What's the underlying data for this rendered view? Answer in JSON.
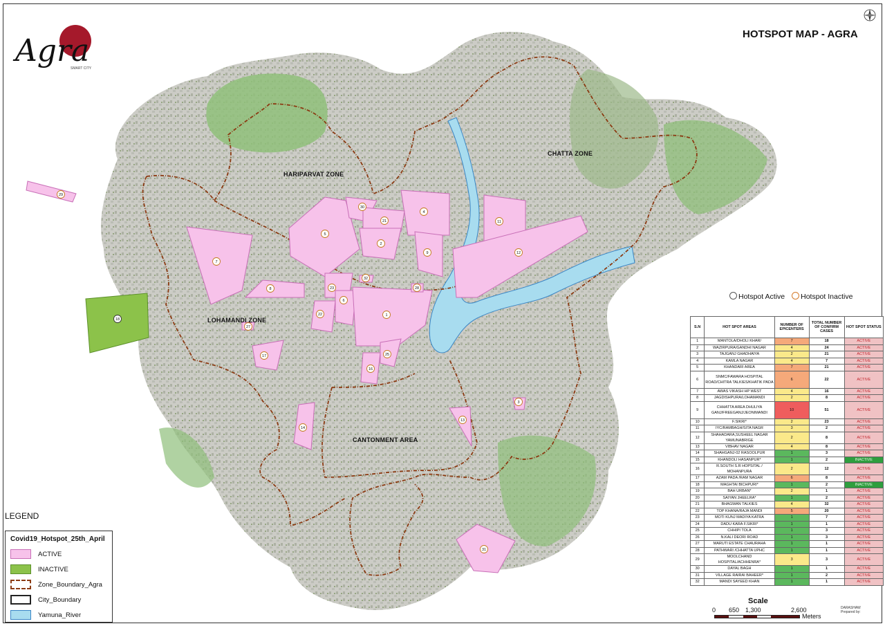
{
  "title": "HOTSPOT MAP - AGRA",
  "logo": {
    "text": "Agra",
    "sub": "SMART CITY"
  },
  "zones": [
    {
      "name": "HARIPARVAT ZONE"
    },
    {
      "name": "CHATTA ZONE"
    },
    {
      "name": "LOHAMANDI ZONE"
    },
    {
      "name": "CANTONMENT AREA"
    }
  ],
  "status_legend": {
    "active": "Hotspot Active",
    "inactive": "Hotspot Inactive"
  },
  "hotspot_labels": [
    "1",
    "2",
    "3",
    "4",
    "5",
    "6",
    "7",
    "8",
    "9",
    "10",
    "11",
    "12",
    "13",
    "14",
    "15",
    "16",
    "17",
    "18",
    "19",
    "20",
    "21",
    "22",
    "23",
    "24",
    "25",
    "26",
    "27",
    "28",
    "29",
    "30",
    "31",
    "32"
  ],
  "table": {
    "headers": [
      "S.N",
      "HOT SPOT AREAS",
      "NUMBER OF EPICENTERS",
      "TOTAL NUMBER OF CONFIRM CASES",
      "HOT SPOT STATUS"
    ],
    "rows": [
      {
        "sn": "1",
        "area": "MANTOLA/DHOLI KHAR/",
        "epi": "7",
        "cases": "18",
        "status": "ACTIVE"
      },
      {
        "sn": "2",
        "area": "WAZIRPURA/GANDHI NAGAR",
        "epi": "4",
        "cases": "24",
        "status": "ACTIVE"
      },
      {
        "sn": "3",
        "area": "TAJGANJ GHADHAIYA",
        "epi": "2",
        "cases": "21",
        "status": "ACTIVE"
      },
      {
        "sn": "4",
        "area": "KAMLA NAGAR",
        "epi": "4",
        "cases": "7",
        "status": "ACTIVE"
      },
      {
        "sn": "5",
        "area": "KHANDARI AREA",
        "epi": "7",
        "cases": "21",
        "status": "ACTIVE"
      },
      {
        "sn": "6",
        "area": "SNMC/FAWARA HOSPITAL ROAD/CHITRA TALKIES/KHATIK PADA",
        "epi": "6",
        "cases": "22",
        "status": "ACTIVE"
      },
      {
        "sn": "7",
        "area": "AWAS VIKASH HP WEST",
        "epi": "4",
        "cases": "16",
        "status": "ACTIVE"
      },
      {
        "sn": "8",
        "area": "JAGDISHPURA/LOHAMANDI",
        "epi": "2",
        "cases": "8",
        "status": "ACTIVE"
      },
      {
        "sn": "9",
        "area": "CHHATTA AREA DHULIYA GANJ/FREEGANJ/JEONIMANDI",
        "epi": "10",
        "cases": "51",
        "status": "ACTIVE"
      },
      {
        "sn": "10",
        "area": "F.SIKRI*",
        "epi": "2",
        "cases": "23",
        "status": "ACTIVE"
      },
      {
        "sn": "11",
        "area": "IYC/RAMBAGH/SITA NAGR",
        "epi": "3",
        "cases": "2",
        "status": "ACTIVE"
      },
      {
        "sn": "12",
        "area": "SHAHADARA,SUSHEEL NAGAR YAMUNABRIGE",
        "epi": "2",
        "cases": "8",
        "status": "ACTIVE"
      },
      {
        "sn": "13",
        "area": "VIBHAV NAGAR",
        "epi": "4",
        "cases": "8",
        "status": "ACTIVE"
      },
      {
        "sn": "14",
        "area": "SHAHGANJ-02 RASOOLPUR",
        "epi": "1",
        "cases": "3",
        "status": "ACTIVE"
      },
      {
        "sn": "15",
        "area": "KHANDOLI HASANPUR*",
        "epi": "1",
        "cases": "2",
        "status": "INACTIVE"
      },
      {
        "sn": "16",
        "area": "R.SOUTH  S.R HOPSITAL / MOHANPURA",
        "epi": "2",
        "cases": "12",
        "status": "ACTIVE"
      },
      {
        "sn": "17",
        "area": "AZAM PADA /RAM NAGAR",
        "epi": "6",
        "cases": "8",
        "status": "ACTIVE"
      },
      {
        "sn": "18",
        "area": "MAGHTAI BICHPURI*",
        "epi": "1",
        "cases": "2",
        "status": "INACTIVE"
      },
      {
        "sn": "19",
        "area": "BAH URBAN*",
        "epi": "2",
        "cases": "1",
        "status": "ACTIVE"
      },
      {
        "sn": "20",
        "area": "SAIYAN JHEELRA*",
        "epi": "1",
        "cases": "2",
        "status": "ACTIVE"
      },
      {
        "sn": "21",
        "area": "BHAGWAN TALKIES",
        "epi": "4",
        "cases": "32",
        "status": "ACTIVE"
      },
      {
        "sn": "22",
        "area": "TOP KHANA/RAJA MANDI",
        "epi": "5",
        "cases": "20",
        "status": "ACTIVE"
      },
      {
        "sn": "23",
        "area": "MOTI KUNJ MADIYA KATRA",
        "epi": "1",
        "cases": "7",
        "status": "ACTIVE"
      },
      {
        "sn": "24",
        "area": "DADU KARA F.SIKRI*",
        "epi": "1",
        "cases": "1",
        "status": "ACTIVE"
      },
      {
        "sn": "25",
        "area": "CHHIPI TOLA",
        "epi": "1",
        "cases": "3",
        "status": "ACTIVE"
      },
      {
        "sn": "26",
        "area": "N.KALI DEORI ROAD",
        "epi": "1",
        "cases": "3",
        "status": "ACTIVE"
      },
      {
        "sn": "27",
        "area": "MARUTI ESTATE CHAURAHA",
        "epi": "1",
        "cases": "1",
        "status": "ACTIVE"
      },
      {
        "sn": "28",
        "area": "PATHWARI /CHHATTA UPHC",
        "epi": "1",
        "cases": "1",
        "status": "ACTIVE"
      },
      {
        "sn": "29",
        "area": "MOOLCHAND HOSPITAL/ACHHENRA*",
        "epi": "3",
        "cases": "3",
        "status": "ACTIVE"
      },
      {
        "sn": "30",
        "area": "DAYAL BAGH",
        "epi": "1",
        "cases": "1",
        "status": "ACTIVE"
      },
      {
        "sn": "31",
        "area": "VILLAGE RAIRAI BAHEER*",
        "epi": "1",
        "cases": "2",
        "status": "ACTIVE"
      },
      {
        "sn": "32",
        "area": "MANDI SAYEED KHAN",
        "epi": "1",
        "cases": "1",
        "status": "ACTIVE"
      }
    ]
  },
  "legend": {
    "title": "LEGEND",
    "subtitle": "Covid19_Hotspot_25th_April",
    "items": [
      {
        "label": "ACTIVE",
        "color": "#f7c2ea"
      },
      {
        "label": "INACTIVE",
        "color": "#8cc24a"
      },
      {
        "label": "Zone_Boundary_Agra",
        "color": "#8b3a12"
      },
      {
        "label": "City_Boundary",
        "color": "#222222"
      },
      {
        "label": "Yamuna_River",
        "color": "#a8dcef"
      }
    ]
  },
  "scale": {
    "title": "Scale",
    "ticks": [
      "0",
      "650",
      "1,300",
      "2,600"
    ],
    "units": "Meters"
  },
  "credits": {
    "line1": "DARASHAW",
    "line2": "Prepared by:"
  },
  "colors": {
    "active_fill": "#f7c2ea",
    "inactive_fill": "#8cc24a",
    "river": "#a8dcef",
    "zone_boundary": "#8b3a12",
    "epi_low": "#5bb85d",
    "epi_mid": "#fbe98a",
    "epi_high": "#f5a97a",
    "epi_max": "#ef5d5d"
  }
}
